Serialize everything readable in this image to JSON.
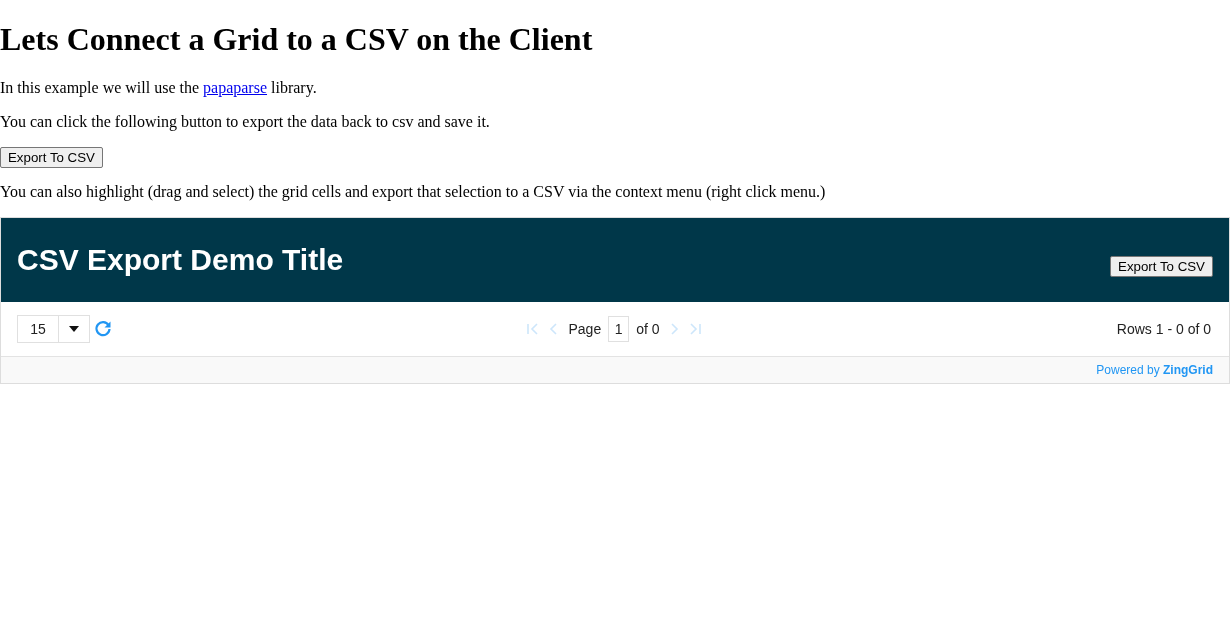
{
  "heading": "Lets Connect a Grid to a CSV on the Client",
  "intro": {
    "before": "In this example we will use the ",
    "link": "papaparse",
    "after": " library."
  },
  "export_note": "You can click the following button to export the data back to csv and save it.",
  "export_button": "Export To CSV",
  "selection_note": "You can also highlight (drag and select) the grid cells and export that selection to a CSV via the context menu (right click menu.)",
  "grid": {
    "title": "CSV Export Demo Title",
    "export_button": "Export To CSV",
    "page_size": "15",
    "pager": {
      "first": {
        "disabled": true
      },
      "prev": {
        "disabled": true
      },
      "page_label": "Page",
      "page": "1",
      "of_label": "of 0",
      "next": {
        "disabled": true
      },
      "last": {
        "disabled": true
      }
    },
    "rows_info": "Rows 1 - 0 of 0",
    "powered_by": {
      "text": "Powered by ",
      "brand": "ZingGrid"
    }
  }
}
